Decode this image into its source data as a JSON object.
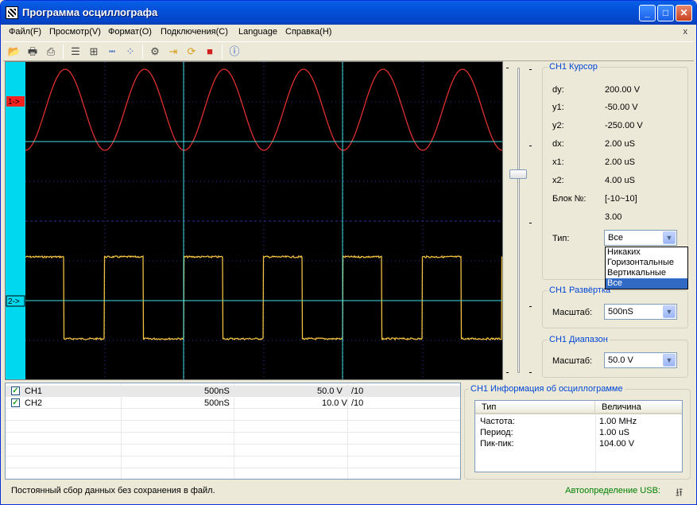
{
  "window": {
    "title": "Программа осциллографа",
    "min": "_",
    "max": "□",
    "close": "✕"
  },
  "menu": [
    "Файл(F)",
    "Просмотр(V)",
    "Формат(O)",
    "Подключения(C)",
    "Language",
    "Справка(H)"
  ],
  "mdi_close": "x",
  "toolbar_icons": [
    "open-icon",
    "print-icon",
    "print-preview-icon",
    "list-icon",
    "grid-icon",
    "dotted-line-icon",
    "points-icon",
    "settings-icon",
    "import-icon",
    "refresh-icon",
    "stop-icon",
    "help-icon"
  ],
  "scope": {
    "ch1_marker": "1->",
    "ch2_marker": "2->",
    "ch1_color": "#E03030",
    "ch2_color": "#F0C040",
    "grid_color": "#3030A0",
    "cursor_color": "#40E0E0"
  },
  "channels": [
    {
      "name": "CH1",
      "timebase": "500nS",
      "voltage": "50.0 V",
      "probe": "/10",
      "checked": true
    },
    {
      "name": "CH2",
      "timebase": "500nS",
      "voltage": "10.0 V",
      "probe": "/10",
      "checked": true
    }
  ],
  "cursor": {
    "title": "CH1 Курсор",
    "dy_label": "dy:",
    "dy": "200.00 V",
    "y1_label": "y1:",
    "y1": "-50.00 V",
    "y2_label": "y2:",
    "y2": "-250.00 V",
    "dx_label": "dx:",
    "dx": "2.00 uS",
    "x1_label": "x1:",
    "x1": "2.00 uS",
    "x2_label": "x2:",
    "x2": "4.00 uS",
    "block_label": "Блок №:",
    "block": "[-10~10]",
    "block_value": "3.00",
    "type_label": "Тип:",
    "type_value": "Все",
    "type_options": [
      "Никаких",
      "Горизонтальные",
      "Вертикальные",
      "Все"
    ],
    "type_selected": 3
  },
  "timebase": {
    "title": "CH1 Развёртка",
    "scale_label": "Масштаб:",
    "scale_value": "500nS"
  },
  "range": {
    "title": "CH1 Диапазон",
    "scale_label": "Масштаб:",
    "scale_value": "50.0 V"
  },
  "info": {
    "title": "CH1 Информация об осциллограмме",
    "col_type": "Тип",
    "col_value": "Величина",
    "rows": [
      {
        "type": "Частота:",
        "value": "1.00 MHz"
      },
      {
        "type": "Период:",
        "value": "1.00 uS"
      },
      {
        "type": "Пик-пик:",
        "value": "104.00 V"
      }
    ]
  },
  "status": {
    "left": "Постоянный сбор данных без сохранения в файл.",
    "right": "Автоопределение USB:"
  }
}
